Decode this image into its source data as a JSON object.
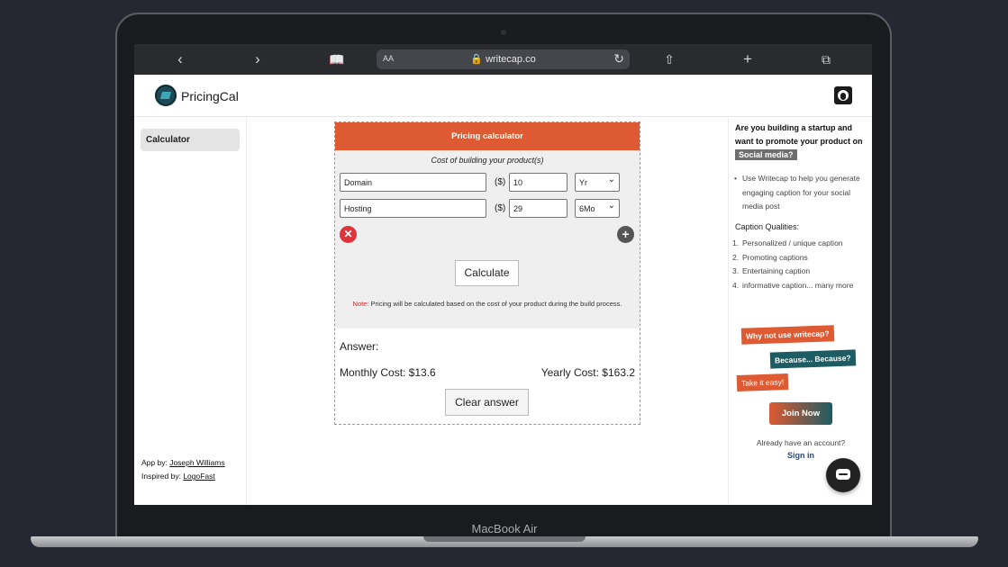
{
  "device": {
    "label": "MacBook Air"
  },
  "browser": {
    "url": "writecap.co",
    "text_size_label": "AA",
    "icons": {
      "back": "chevron-left-icon",
      "forward": "chevron-right-icon",
      "bookmarks": "book-icon",
      "reload": "reload-icon",
      "share": "share-icon",
      "new_tab": "plus-icon",
      "tabs": "tabs-icon"
    }
  },
  "header": {
    "brand": "PricingCal",
    "github_icon": "github-icon"
  },
  "sidebar": {
    "items": [
      {
        "label": "Calculator"
      }
    ],
    "credits": {
      "app_by_label": "App by:",
      "app_by_name": "Joseph Williams",
      "inspired_by_label": "Inspired by:",
      "inspired_by_name": "LogoFast"
    }
  },
  "calculator": {
    "title": "Pricing calculator",
    "subtitle": "Cost of building your product(s)",
    "rows": [
      {
        "name": "Domain",
        "currency": "($)",
        "cost": "10",
        "period": "Yr"
      },
      {
        "name": "Hosting",
        "currency": "($)",
        "cost": "29",
        "period": "6Mo"
      }
    ],
    "calculate_label": "Calculate",
    "note_label": "Note:",
    "note_text": "Pricing will be calculated based on the cost of your product during the build process.",
    "answer_label": "Answer:",
    "monthly": "Monthly Cost: $13.6",
    "yearly": "Yearly Cost: $163.2",
    "clear_label": "Clear answer"
  },
  "promo": {
    "line1": "Are you building a startup and want to promote your product on",
    "tag": "Social media?",
    "bullet": "Use Writecap to help you generate engaging caption for your social media post",
    "qualities_title": "Caption Qualities:",
    "qualities": [
      "Personalized / unique caption",
      "Promoting captions",
      "Entertaining caption",
      "informative caption... many more"
    ],
    "chip1": "Why not use writecap?",
    "chip2": "Because... Because?",
    "chip3": "Take it easy!",
    "join": "Join Now",
    "already": "Already have an account?",
    "signin": "Sign in"
  },
  "colors": {
    "accent": "#dd5a32",
    "teal": "#1d5c63"
  }
}
